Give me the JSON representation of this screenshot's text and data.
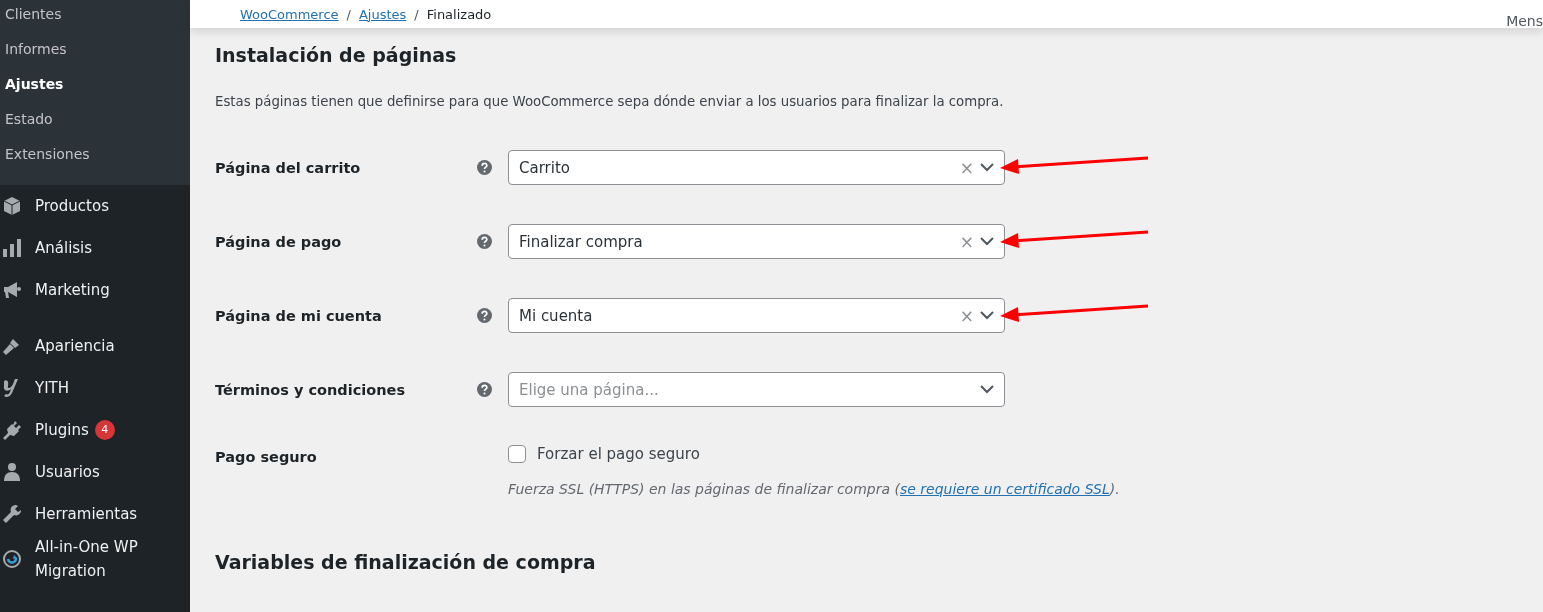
{
  "sidebar": {
    "submenu": [
      {
        "label": "Clientes",
        "selected": false
      },
      {
        "label": "Informes",
        "selected": false
      },
      {
        "label": "Ajustes",
        "selected": true
      },
      {
        "label": "Estado",
        "selected": false
      },
      {
        "label": "Extensiones",
        "selected": false
      }
    ],
    "menu": [
      {
        "label": "Productos"
      },
      {
        "label": "Análisis"
      },
      {
        "label": "Marketing"
      },
      {
        "label": "Apariencia"
      },
      {
        "label": "YITH"
      },
      {
        "label": "Plugins",
        "badge": "4"
      },
      {
        "label": "Usuarios"
      },
      {
        "label": "Herramientas"
      },
      {
        "label": "All-in-One WP Migration"
      }
    ]
  },
  "header": {
    "breadcrumb": [
      {
        "label": "WooCommerce",
        "kind": "link"
      },
      {
        "label": "Ajustes",
        "kind": "link"
      },
      {
        "label": "Finalizado",
        "kind": "current"
      }
    ],
    "separator": "/",
    "right_text": "Mens"
  },
  "section": {
    "title": "Instalación de páginas",
    "description": "Estas páginas tienen que definirse para que WooCommerce sepa dónde enviar a los usuarios para finalizar la compra."
  },
  "fields": [
    {
      "kind": "select",
      "label": "Página del carrito",
      "value": "Carrito",
      "clear": "×",
      "arrow": true
    },
    {
      "kind": "select",
      "label": "Página de pago",
      "value": "Finalizar compra",
      "clear": "×",
      "arrow": true
    },
    {
      "kind": "select",
      "label": "Página de mi cuenta",
      "value": "Mi cuenta",
      "clear": "×",
      "arrow": true
    },
    {
      "kind": "select",
      "label": "Términos y condiciones",
      "placeholder": "Elige una página...",
      "arrow": false
    },
    {
      "kind": "checkbox",
      "label": "Pago seguro",
      "option": "Forzar el pago seguro",
      "checked": false,
      "help_before": "Fuerza SSL (HTTPS) en las páginas de finalizar compra (",
      "help_link": "se requiere un certificado SSL",
      "help_after": ")."
    }
  ],
  "section2": {
    "title": "Variables de finalización de compra"
  }
}
